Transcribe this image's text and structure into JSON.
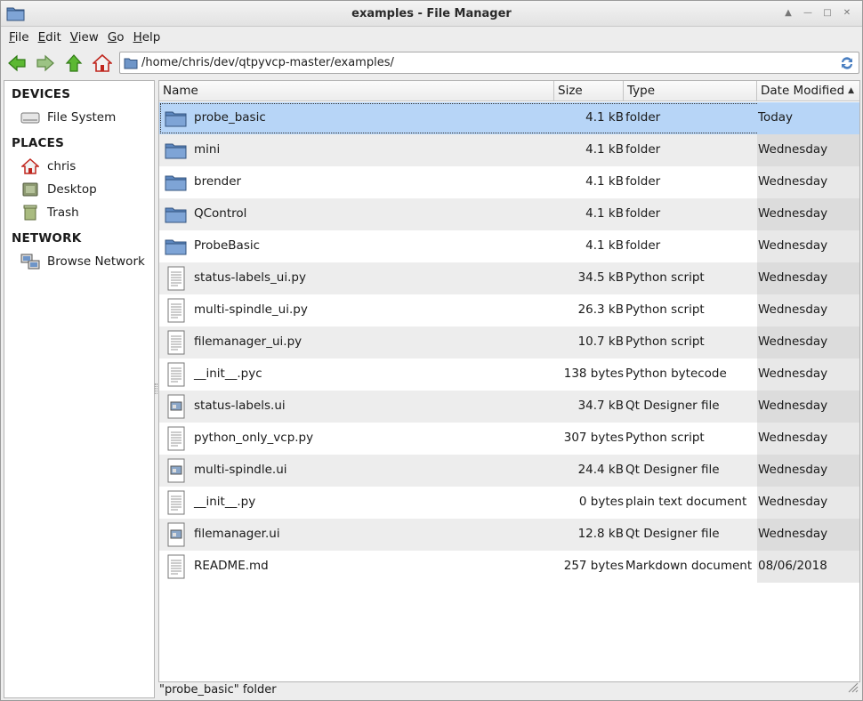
{
  "window": {
    "title": "examples - File Manager"
  },
  "menubar": {
    "items": [
      {
        "ul": "F",
        "rest": "ile"
      },
      {
        "ul": "E",
        "rest": "dit"
      },
      {
        "ul": "V",
        "rest": "iew"
      },
      {
        "ul": "G",
        "rest": "o"
      },
      {
        "ul": "H",
        "rest": "elp"
      }
    ]
  },
  "toolbar": {
    "path": "/home/chris/dev/qtpyvcp-master/examples/"
  },
  "sidebar": {
    "devices_heading": "DEVICES",
    "places_heading": "PLACES",
    "network_heading": "NETWORK",
    "filesystem": "File System",
    "home": "chris",
    "desktop": "Desktop",
    "trash": "Trash",
    "browse_network": "Browse Network"
  },
  "columns": {
    "name": "Name",
    "size": "Size",
    "type": "Type",
    "date": "Date Modified"
  },
  "files": [
    {
      "name": "probe_basic",
      "size": "4.1 kB",
      "type": "folder",
      "date": "Today",
      "icon": "folder-icon"
    },
    {
      "name": "mini",
      "size": "4.1 kB",
      "type": "folder",
      "date": "Wednesday",
      "icon": "folder-icon"
    },
    {
      "name": "brender",
      "size": "4.1 kB",
      "type": "folder",
      "date": "Wednesday",
      "icon": "folder-icon"
    },
    {
      "name": "QControl",
      "size": "4.1 kB",
      "type": "folder",
      "date": "Wednesday",
      "icon": "folder-icon"
    },
    {
      "name": "ProbeBasic",
      "size": "4.1 kB",
      "type": "folder",
      "date": "Wednesday",
      "icon": "folder-icon"
    },
    {
      "name": "status-labels_ui.py",
      "size": "34.5 kB",
      "type": "Python script",
      "date": "Wednesday",
      "icon": "text-file-icon"
    },
    {
      "name": "multi-spindle_ui.py",
      "size": "26.3 kB",
      "type": "Python script",
      "date": "Wednesday",
      "icon": "text-file-icon"
    },
    {
      "name": "filemanager_ui.py",
      "size": "10.7 kB",
      "type": "Python script",
      "date": "Wednesday",
      "icon": "text-file-icon"
    },
    {
      "name": "__init__.pyc",
      "size": "138 bytes",
      "type": "Python bytecode",
      "date": "Wednesday",
      "icon": "text-file-icon"
    },
    {
      "name": "status-labels.ui",
      "size": "34.7 kB",
      "type": "Qt Designer file",
      "date": "Wednesday",
      "icon": "image-file-icon"
    },
    {
      "name": "python_only_vcp.py",
      "size": "307 bytes",
      "type": "Python script",
      "date": "Wednesday",
      "icon": "text-file-icon"
    },
    {
      "name": "multi-spindle.ui",
      "size": "24.4 kB",
      "type": "Qt Designer file",
      "date": "Wednesday",
      "icon": "image-file-icon"
    },
    {
      "name": "__init__.py",
      "size": "0 bytes",
      "type": "plain text document",
      "date": "Wednesday",
      "icon": "text-file-icon"
    },
    {
      "name": "filemanager.ui",
      "size": "12.8 kB",
      "type": "Qt Designer file",
      "date": "Wednesday",
      "icon": "image-file-icon"
    },
    {
      "name": "README.md",
      "size": "257 bytes",
      "type": "Markdown document",
      "date": "08/06/2018",
      "icon": "text-file-icon"
    }
  ],
  "statusbar": {
    "text": "\"probe_basic\" folder"
  },
  "colors": {
    "selection": "#b7d5f7",
    "folder": "#6e95c8",
    "arrow_green": "#4caf2a"
  }
}
